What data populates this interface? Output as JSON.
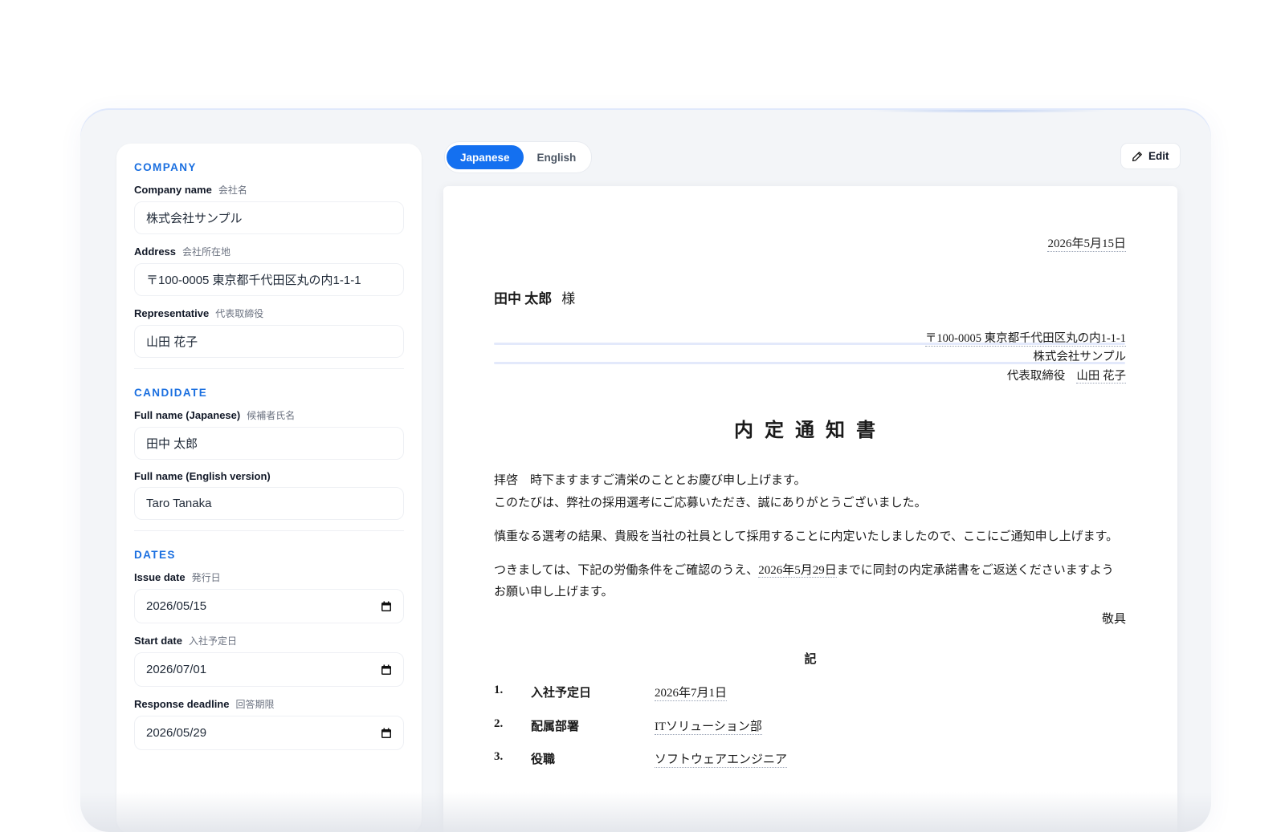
{
  "form": {
    "company": {
      "title": "COMPANY",
      "name_label": "Company name",
      "name_label_jp": "会社名",
      "name_value": "株式会社サンプル",
      "address_label": "Address",
      "address_label_jp": "会社所在地",
      "address_value": "〒100-0005 東京都千代田区丸の内1-1-1",
      "rep_label": "Representative",
      "rep_label_jp": "代表取締役",
      "rep_value": "山田 花子"
    },
    "candidate": {
      "title": "CANDIDATE",
      "jp_name_label": "Full name (Japanese)",
      "jp_name_label_jp": "候補者氏名",
      "jp_name_value": "田中 太郎",
      "en_name_label": "Full name (English version)",
      "en_name_value": "Taro Tanaka"
    },
    "dates": {
      "title": "DATES",
      "issue_label": "Issue date",
      "issue_label_jp": "発行日",
      "issue_value": "2026/05/15",
      "start_label": "Start date",
      "start_label_jp": "入社予定日",
      "start_value": "2026/07/01",
      "deadline_label": "Response deadline",
      "deadline_label_jp": "回答期限",
      "deadline_value": "2026/05/29"
    }
  },
  "toolbar": {
    "lang_japanese": "Japanese",
    "lang_english": "English",
    "active_lang": "Japanese",
    "edit_label": "Edit"
  },
  "document": {
    "date": "2026年5月15日",
    "recipient_name": "田中 太郎",
    "recipient_suffix": "様",
    "sender_address": "〒100-0005 東京都千代田区丸の内1-1-1",
    "sender_company": "株式会社サンプル",
    "sender_rep_title": "代表取締役",
    "sender_rep_name": "山田 花子",
    "title": "内定通知書",
    "para1_a": "拝啓　時下ますますご清栄のこととお慶び申し上げます。",
    "para1_b": "このたびは、弊社の採用選考にご応募いただき、誠にありがとうございました。",
    "para2": "慎重なる選考の結果、貴殿を当社の社員として採用することに内定いたしましたので、ここにご通知申し上げます。",
    "para3_pre": "つきましては、下記の労働条件をご確認のうえ、",
    "para3_date": "2026年5月29日",
    "para3_post": "までに同封の内定承諾書をご返送くださいますよう",
    "para3_b": "お願い申し上げます。",
    "closing": "敬具",
    "ki": "記",
    "items": [
      {
        "num": "1.",
        "label": "入社予定日",
        "value": "2026年7月1日"
      },
      {
        "num": "2.",
        "label": "配属部署",
        "value": "ITソリューション部"
      },
      {
        "num": "3.",
        "label": "役職",
        "value": "ソフトウェアエンジニア"
      }
    ]
  },
  "colors": {
    "accent": "#1470f0",
    "section_title": "#1a6fe0",
    "frame_bg": "#f3f5f8"
  }
}
